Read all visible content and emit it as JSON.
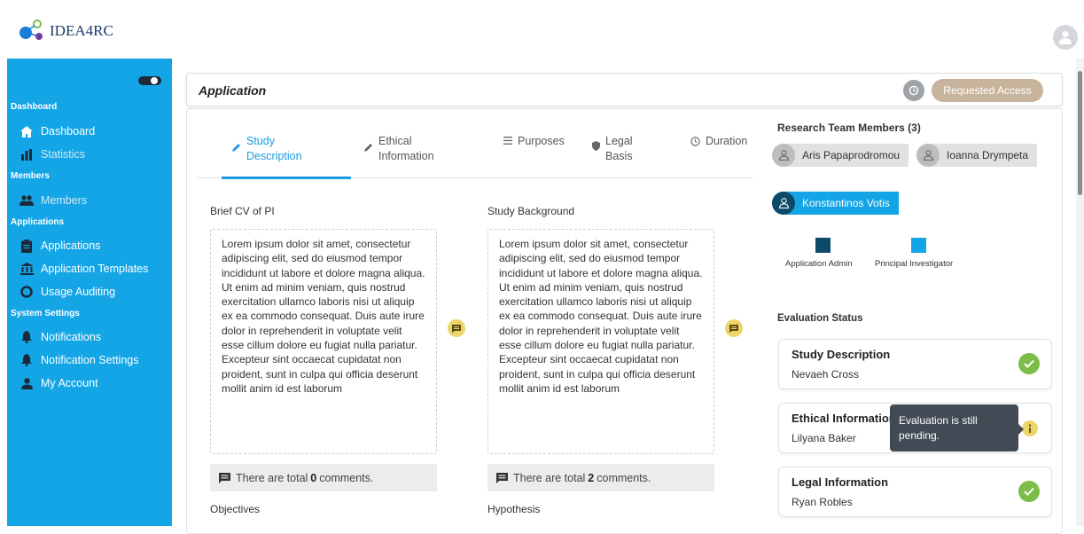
{
  "app": {
    "logo_text": "IDEA4RC"
  },
  "sidebar": {
    "sections": [
      "Dashboard",
      "Members",
      "Applications",
      "System Settings"
    ],
    "items": [
      {
        "label": "Dashboard",
        "icon": "home-icon"
      },
      {
        "label": "Statistics",
        "icon": "bar-chart-icon"
      },
      {
        "label": "Members",
        "icon": "users-icon"
      },
      {
        "label": "Applications",
        "icon": "clipboard-icon"
      },
      {
        "label": "Application Templates",
        "icon": "bank-icon"
      },
      {
        "label": "Usage Auditing",
        "icon": "circle-icon"
      },
      {
        "label": "Notifications",
        "icon": "bell-icon"
      },
      {
        "label": "Notification Settings",
        "icon": "bell-icon"
      },
      {
        "label": "My Account",
        "icon": "user-icon"
      }
    ]
  },
  "header": {
    "title": "Application",
    "request_button": "Requested Access"
  },
  "tabs": [
    {
      "line1": "Study",
      "line2": "Description",
      "icon": "pencil-icon",
      "active": true
    },
    {
      "line1": "Ethical",
      "line2": "Information",
      "icon": "pencil-icon",
      "active": false
    },
    {
      "line1": "Purposes",
      "line2": "",
      "icon": "list-icon",
      "active": false
    },
    {
      "line1": "Legal",
      "line2": "Basis",
      "icon": "shield-icon",
      "active": false
    },
    {
      "line1": "Duration",
      "line2": "",
      "icon": "clock-icon",
      "active": false
    }
  ],
  "fields": {
    "brief_cv": {
      "label": "Brief CV of PI",
      "text": "Lorem ipsum dolor sit amet, consectetur adipiscing elit, sed do eiusmod tempor incididunt ut labore et dolore magna aliqua. Ut enim ad minim veniam, quis nostrud exercitation ullamco laboris nisi ut aliquip ex ea commodo consequat. Duis aute irure dolor in reprehenderit in voluptate velit esse cillum dolore eu fugiat nulla pariatur. Excepteur sint occaecat cupidatat non proident, sunt in culpa qui officia deserunt mollit anim id est laborum",
      "comments_prefix": "There are total",
      "comments_count": "0",
      "comments_suffix": "comments."
    },
    "study_background": {
      "label": "Study Background",
      "text": "Lorem ipsum dolor sit amet, consectetur adipiscing elit, sed do eiusmod tempor incididunt ut labore et dolore magna aliqua. Ut enim ad minim veniam, quis nostrud exercitation ullamco laboris nisi ut aliquip ex ea commodo consequat. Duis aute irure dolor in reprehenderit in voluptate velit esse cillum dolore eu fugiat nulla pariatur. Excepteur sint occaecat cupidatat non proident, sunt in culpa qui officia deserunt mollit anim id est laborum",
      "comments_prefix": "There are total",
      "comments_count": "2",
      "comments_suffix": "comments."
    },
    "objectives": {
      "label": "Objectives"
    },
    "hypothesis": {
      "label": "Hypothesis"
    }
  },
  "team": {
    "title": "Research Team Members (3)",
    "members": [
      "Aris Papaprodromou",
      "Ioanna Drympeta",
      "Konstantinos Votis"
    ],
    "legend": [
      {
        "label": "Application Admin",
        "color": "#0d4a6a"
      },
      {
        "label": "Principal Investigator",
        "color": "#13a5e6"
      }
    ]
  },
  "evaluation": {
    "title": "Evaluation Status",
    "items": [
      {
        "title": "Study Description",
        "person": "Nevaeh Cross",
        "status": "approved"
      },
      {
        "title": "Ethical Information",
        "person": "Lilyana Baker",
        "status": "pending"
      },
      {
        "title": "Legal Information",
        "person": "Ryan Robles",
        "status": "approved"
      }
    ],
    "tooltip": "Evaluation is still pending."
  },
  "colors": {
    "sidebar": "#13a5e6",
    "accent": "#1a9be0",
    "approved": "#7cbd4a",
    "pending": "#ecd66c",
    "request_button": "#c8b49c"
  }
}
